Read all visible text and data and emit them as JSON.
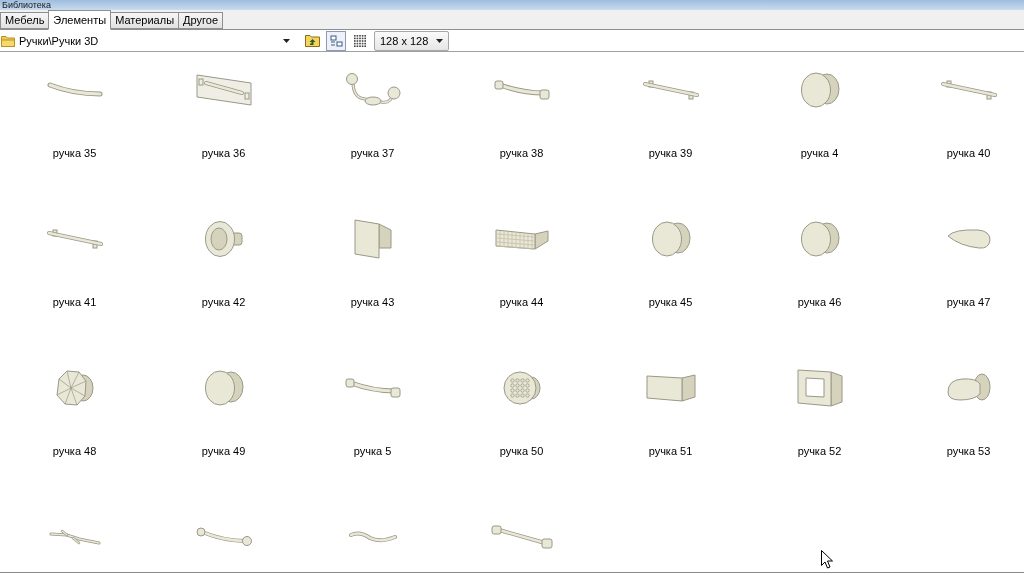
{
  "window": {
    "title": "Библиотека"
  },
  "tabs": [
    {
      "label": "Мебель",
      "selected": false
    },
    {
      "label": "Элементы",
      "selected": true
    },
    {
      "label": "Материалы",
      "selected": false
    },
    {
      "label": "Другое",
      "selected": false
    }
  ],
  "toolbar": {
    "path": "Ручки\\Ручки 3D",
    "view_buttons": [
      {
        "kind": "thumbnails",
        "selected": true
      },
      {
        "kind": "grid",
        "selected": false
      }
    ],
    "thumbnail_size": "128 x 128"
  },
  "items": [
    {
      "label": "ручка 35",
      "kind": "arc"
    },
    {
      "label": "ручка 36",
      "kind": "plate"
    },
    {
      "label": "ручка 37",
      "kind": "bail"
    },
    {
      "label": "ручка 38",
      "kind": "bow"
    },
    {
      "label": "ручка 39",
      "kind": "bar"
    },
    {
      "label": "ручка 4",
      "kind": "knob"
    },
    {
      "label": "ручка 40",
      "kind": "bar"
    },
    {
      "label": "ручка 41",
      "kind": "bar"
    },
    {
      "label": "ручка 42",
      "kind": "cup"
    },
    {
      "label": "ручка 43",
      "kind": "square"
    },
    {
      "label": "ручка 44",
      "kind": "grille"
    },
    {
      "label": "ручка 45",
      "kind": "knob"
    },
    {
      "label": "ручка 46",
      "kind": "knob"
    },
    {
      "label": "ручка 47",
      "kind": "drop"
    },
    {
      "label": "ручка 48",
      "kind": "faceted"
    },
    {
      "label": "ручка 49",
      "kind": "knob"
    },
    {
      "label": "ручка 5",
      "kind": "bow"
    },
    {
      "label": "ручка 50",
      "kind": "dotted"
    },
    {
      "label": "ручка 51",
      "kind": "block"
    },
    {
      "label": "ручка 52",
      "kind": "frame"
    },
    {
      "label": "ручка 53",
      "kind": "mushroom"
    },
    {
      "kind": "twig"
    },
    {
      "kind": "curve"
    },
    {
      "kind": "wave"
    },
    {
      "kind": "rod"
    }
  ]
}
